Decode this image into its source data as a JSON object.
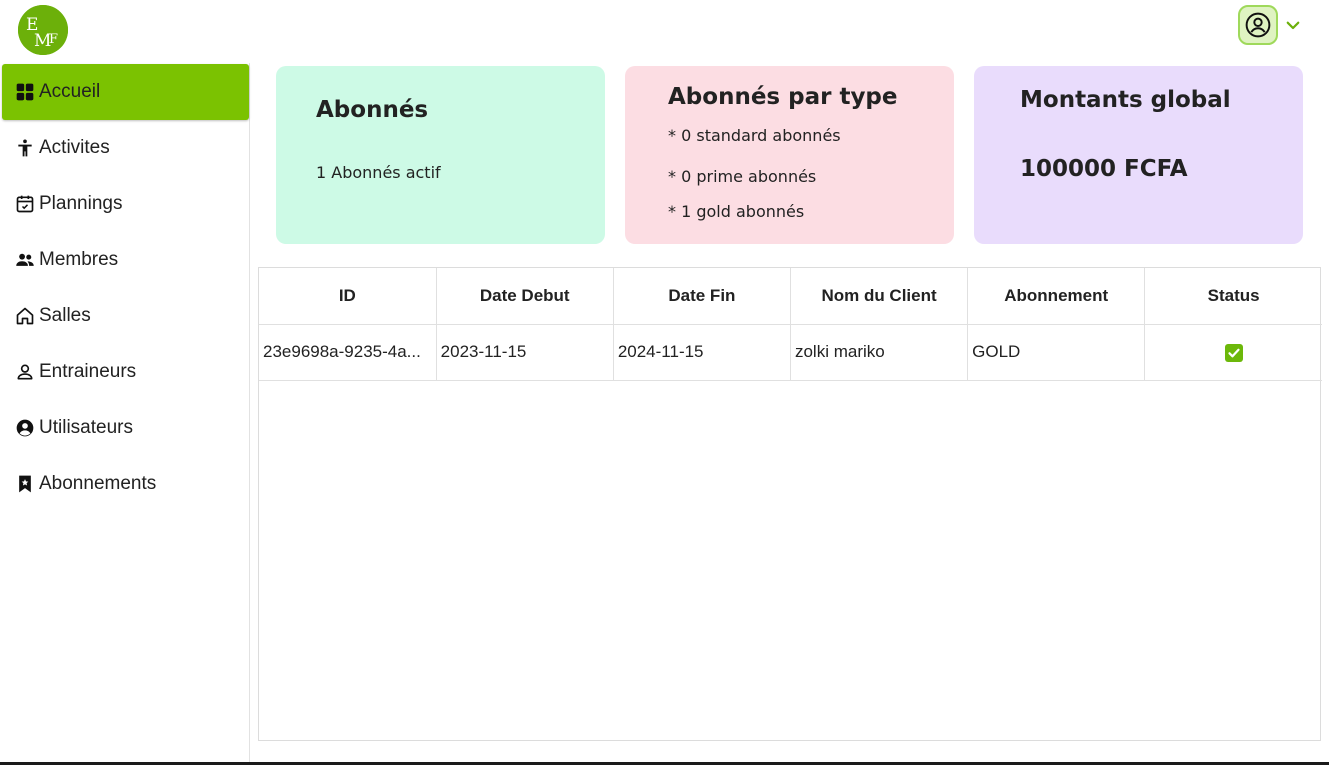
{
  "brand": {
    "logo_text": "EMF",
    "accent": "#7bc201"
  },
  "header": {
    "profile_icon": "user-circle-icon",
    "menu_icon": "chevron-down-icon"
  },
  "sidebar": {
    "items": [
      {
        "label": "Accueil",
        "icon": "dashboard-icon",
        "active": true
      },
      {
        "label": "Activites",
        "icon": "person-activity-icon",
        "active": false
      },
      {
        "label": "Plannings",
        "icon": "calendar-check-icon",
        "active": false
      },
      {
        "label": "Membres",
        "icon": "group-icon",
        "active": false
      },
      {
        "label": "Salles",
        "icon": "home-icon",
        "active": false
      },
      {
        "label": "Entraineurs",
        "icon": "person-icon",
        "active": false
      },
      {
        "label": "Utilisateurs",
        "icon": "user-circle-icon",
        "active": false
      },
      {
        "label": "Abonnements",
        "icon": "bookmark-star-icon",
        "active": false
      }
    ]
  },
  "cards": {
    "subscribers": {
      "title": "Abonnés",
      "text": "1 Abonnés actif",
      "color": "#cdfae6"
    },
    "by_type": {
      "title": "Abonnés par type",
      "lines": [
        "* 0 standard abonnés",
        "* 0 prime abonnés",
        "* 1 gold abonnés"
      ],
      "color": "#fcdde3"
    },
    "amount": {
      "title": "Montants global",
      "value": "100000 FCFA",
      "color": "#e9dcfc"
    }
  },
  "table": {
    "headers": [
      "ID",
      "Date Debut",
      "Date Fin",
      "Nom du Client",
      "Abonnement",
      "Status"
    ],
    "rows": [
      {
        "id": "23e9698a-9235-4a...",
        "start": "2023-11-15",
        "end": "2024-11-15",
        "client": "zolki mariko",
        "plan": "GOLD",
        "status": "active"
      }
    ]
  }
}
